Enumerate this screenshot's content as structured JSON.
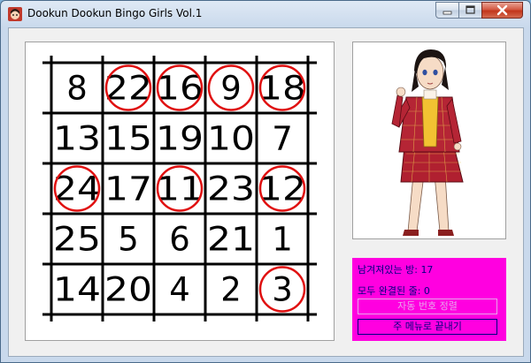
{
  "window": {
    "title": "Dookun Dookun Bingo Girls Vol.1",
    "icon": "girl-face-icon"
  },
  "board": {
    "rows": [
      [
        {
          "n": "8",
          "marked": false
        },
        {
          "n": "22",
          "marked": true
        },
        {
          "n": "16",
          "marked": true
        },
        {
          "n": "9",
          "marked": true
        },
        {
          "n": "18",
          "marked": true
        }
      ],
      [
        {
          "n": "13",
          "marked": false
        },
        {
          "n": "15",
          "marked": false
        },
        {
          "n": "19",
          "marked": false
        },
        {
          "n": "10",
          "marked": false
        },
        {
          "n": "7",
          "marked": false
        }
      ],
      [
        {
          "n": "24",
          "marked": true
        },
        {
          "n": "17",
          "marked": false
        },
        {
          "n": "11",
          "marked": true
        },
        {
          "n": "23",
          "marked": false
        },
        {
          "n": "12",
          "marked": true
        }
      ],
      [
        {
          "n": "25",
          "marked": false
        },
        {
          "n": "5",
          "marked": false
        },
        {
          "n": "6",
          "marked": false
        },
        {
          "n": "21",
          "marked": false
        },
        {
          "n": "1",
          "marked": false
        }
      ],
      [
        {
          "n": "14",
          "marked": false
        },
        {
          "n": "20",
          "marked": false
        },
        {
          "n": "4",
          "marked": false
        },
        {
          "n": "2",
          "marked": false
        },
        {
          "n": "3",
          "marked": true
        }
      ]
    ],
    "line_color": "#000000",
    "mark_color": "#e01010"
  },
  "picture": {
    "subject": "anime-girl-red-plaid-suit"
  },
  "info": {
    "remaining_label": "남겨져있는 방:",
    "remaining_value": "17",
    "completed_label": "모두 완결된 줄:",
    "completed_value": "0",
    "auto_button_label": "자동 번호 정렬",
    "menu_button_label": "주 메뉴로 끝내기",
    "panel_color": "#ff00e0",
    "text_color": "#000080"
  }
}
